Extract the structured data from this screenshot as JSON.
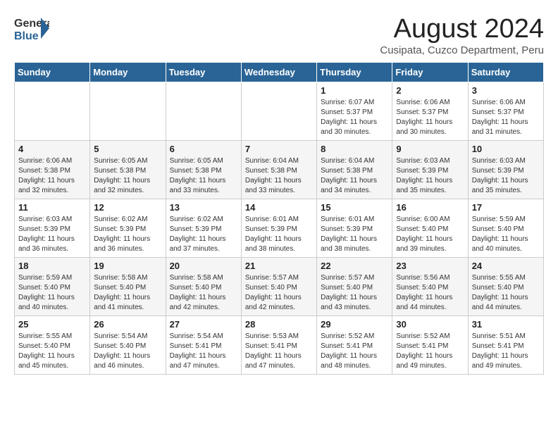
{
  "header": {
    "logo_general": "General",
    "logo_blue": "Blue",
    "month": "August 2024",
    "location": "Cusipata, Cuzco Department, Peru"
  },
  "weekdays": [
    "Sunday",
    "Monday",
    "Tuesday",
    "Wednesday",
    "Thursday",
    "Friday",
    "Saturday"
  ],
  "weeks": [
    [
      {
        "day": "",
        "detail": ""
      },
      {
        "day": "",
        "detail": ""
      },
      {
        "day": "",
        "detail": ""
      },
      {
        "day": "",
        "detail": ""
      },
      {
        "day": "1",
        "detail": "Sunrise: 6:07 AM\nSunset: 5:37 PM\nDaylight: 11 hours\nand 30 minutes."
      },
      {
        "day": "2",
        "detail": "Sunrise: 6:06 AM\nSunset: 5:37 PM\nDaylight: 11 hours\nand 30 minutes."
      },
      {
        "day": "3",
        "detail": "Sunrise: 6:06 AM\nSunset: 5:37 PM\nDaylight: 11 hours\nand 31 minutes."
      }
    ],
    [
      {
        "day": "4",
        "detail": "Sunrise: 6:06 AM\nSunset: 5:38 PM\nDaylight: 11 hours\nand 32 minutes."
      },
      {
        "day": "5",
        "detail": "Sunrise: 6:05 AM\nSunset: 5:38 PM\nDaylight: 11 hours\nand 32 minutes."
      },
      {
        "day": "6",
        "detail": "Sunrise: 6:05 AM\nSunset: 5:38 PM\nDaylight: 11 hours\nand 33 minutes."
      },
      {
        "day": "7",
        "detail": "Sunrise: 6:04 AM\nSunset: 5:38 PM\nDaylight: 11 hours\nand 33 minutes."
      },
      {
        "day": "8",
        "detail": "Sunrise: 6:04 AM\nSunset: 5:38 PM\nDaylight: 11 hours\nand 34 minutes."
      },
      {
        "day": "9",
        "detail": "Sunrise: 6:03 AM\nSunset: 5:39 PM\nDaylight: 11 hours\nand 35 minutes."
      },
      {
        "day": "10",
        "detail": "Sunrise: 6:03 AM\nSunset: 5:39 PM\nDaylight: 11 hours\nand 35 minutes."
      }
    ],
    [
      {
        "day": "11",
        "detail": "Sunrise: 6:03 AM\nSunset: 5:39 PM\nDaylight: 11 hours\nand 36 minutes."
      },
      {
        "day": "12",
        "detail": "Sunrise: 6:02 AM\nSunset: 5:39 PM\nDaylight: 11 hours\nand 36 minutes."
      },
      {
        "day": "13",
        "detail": "Sunrise: 6:02 AM\nSunset: 5:39 PM\nDaylight: 11 hours\nand 37 minutes."
      },
      {
        "day": "14",
        "detail": "Sunrise: 6:01 AM\nSunset: 5:39 PM\nDaylight: 11 hours\nand 38 minutes."
      },
      {
        "day": "15",
        "detail": "Sunrise: 6:01 AM\nSunset: 5:39 PM\nDaylight: 11 hours\nand 38 minutes."
      },
      {
        "day": "16",
        "detail": "Sunrise: 6:00 AM\nSunset: 5:40 PM\nDaylight: 11 hours\nand 39 minutes."
      },
      {
        "day": "17",
        "detail": "Sunrise: 5:59 AM\nSunset: 5:40 PM\nDaylight: 11 hours\nand 40 minutes."
      }
    ],
    [
      {
        "day": "18",
        "detail": "Sunrise: 5:59 AM\nSunset: 5:40 PM\nDaylight: 11 hours\nand 40 minutes."
      },
      {
        "day": "19",
        "detail": "Sunrise: 5:58 AM\nSunset: 5:40 PM\nDaylight: 11 hours\nand 41 minutes."
      },
      {
        "day": "20",
        "detail": "Sunrise: 5:58 AM\nSunset: 5:40 PM\nDaylight: 11 hours\nand 42 minutes."
      },
      {
        "day": "21",
        "detail": "Sunrise: 5:57 AM\nSunset: 5:40 PM\nDaylight: 11 hours\nand 42 minutes."
      },
      {
        "day": "22",
        "detail": "Sunrise: 5:57 AM\nSunset: 5:40 PM\nDaylight: 11 hours\nand 43 minutes."
      },
      {
        "day": "23",
        "detail": "Sunrise: 5:56 AM\nSunset: 5:40 PM\nDaylight: 11 hours\nand 44 minutes."
      },
      {
        "day": "24",
        "detail": "Sunrise: 5:55 AM\nSunset: 5:40 PM\nDaylight: 11 hours\nand 44 minutes."
      }
    ],
    [
      {
        "day": "25",
        "detail": "Sunrise: 5:55 AM\nSunset: 5:40 PM\nDaylight: 11 hours\nand 45 minutes."
      },
      {
        "day": "26",
        "detail": "Sunrise: 5:54 AM\nSunset: 5:40 PM\nDaylight: 11 hours\nand 46 minutes."
      },
      {
        "day": "27",
        "detail": "Sunrise: 5:54 AM\nSunset: 5:41 PM\nDaylight: 11 hours\nand 47 minutes."
      },
      {
        "day": "28",
        "detail": "Sunrise: 5:53 AM\nSunset: 5:41 PM\nDaylight: 11 hours\nand 47 minutes."
      },
      {
        "day": "29",
        "detail": "Sunrise: 5:52 AM\nSunset: 5:41 PM\nDaylight: 11 hours\nand 48 minutes."
      },
      {
        "day": "30",
        "detail": "Sunrise: 5:52 AM\nSunset: 5:41 PM\nDaylight: 11 hours\nand 49 minutes."
      },
      {
        "day": "31",
        "detail": "Sunrise: 5:51 AM\nSunset: 5:41 PM\nDaylight: 11 hours\nand 49 minutes."
      }
    ]
  ]
}
